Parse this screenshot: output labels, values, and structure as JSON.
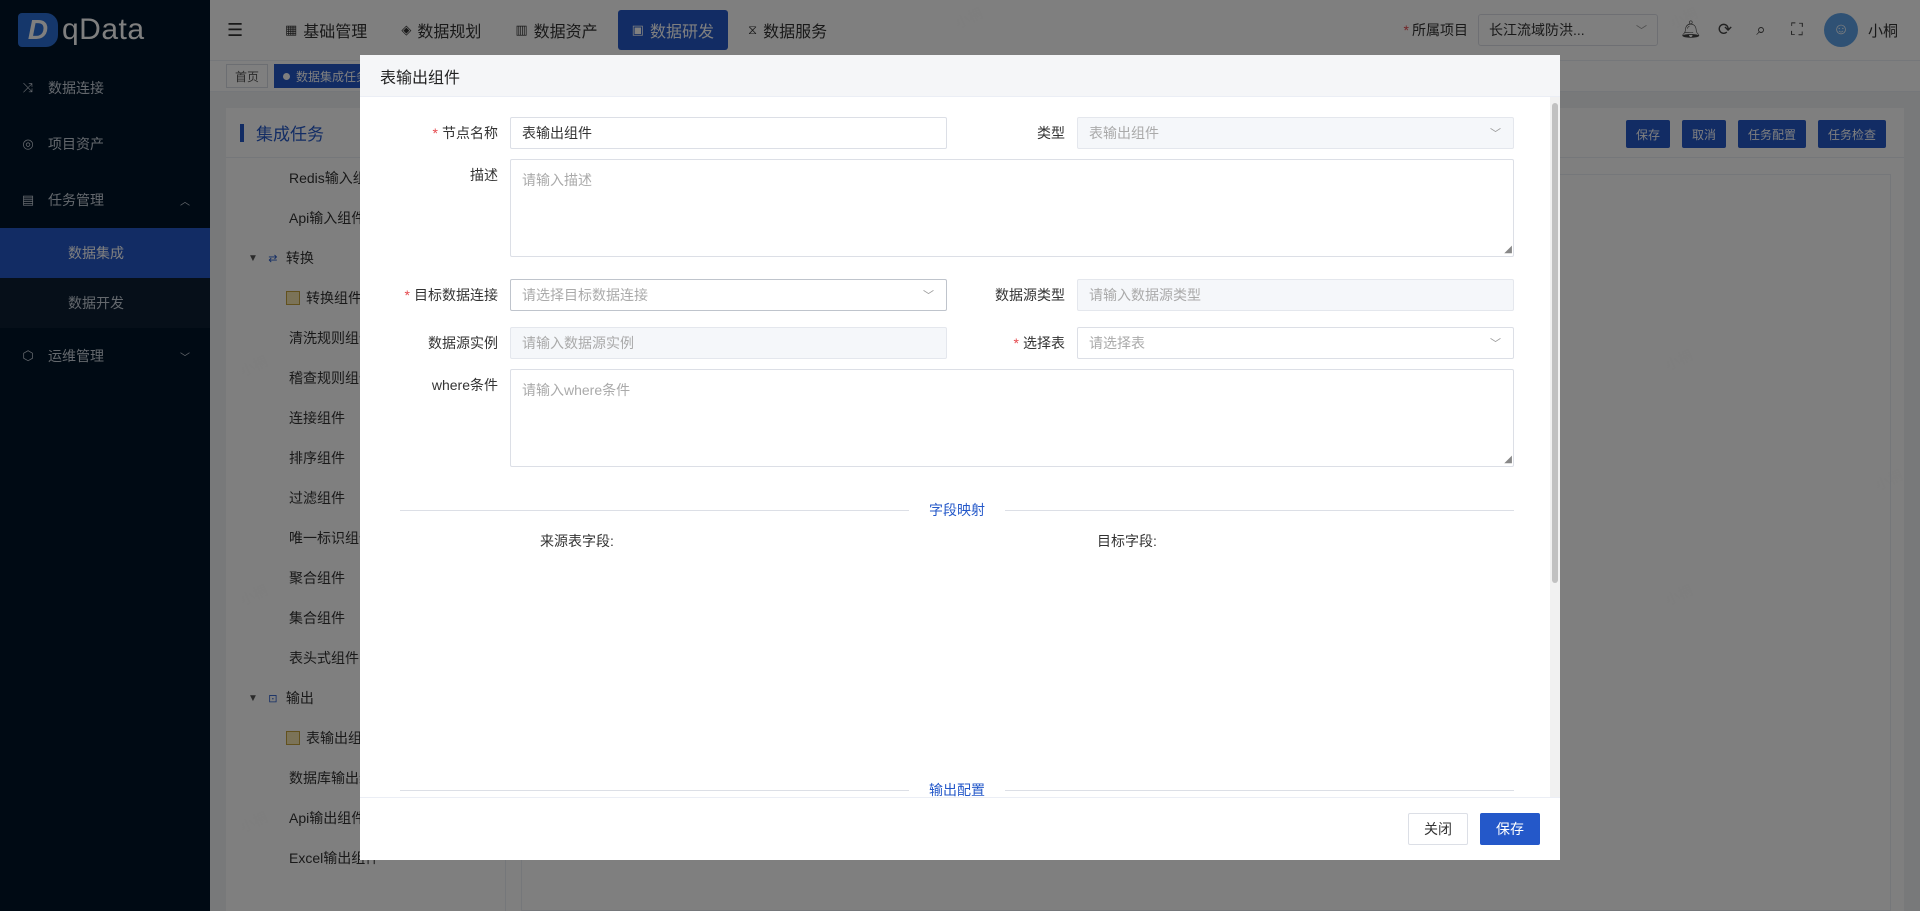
{
  "app": {
    "logo_text": "qData",
    "logo_mark": "D"
  },
  "sidebar": {
    "items": [
      {
        "label": "数据连接",
        "icon": "shuffle-icon",
        "glyph": "⤨"
      },
      {
        "label": "项目资产",
        "icon": "target-icon",
        "glyph": "◎"
      },
      {
        "label": "任务管理",
        "icon": "document-icon",
        "glyph": "▤",
        "arrow": "︿"
      },
      {
        "label": "运维管理",
        "icon": "cube-icon",
        "glyph": "⬡",
        "arrow": "﹀"
      }
    ],
    "subitems": [
      {
        "label": "数据集成",
        "active": true
      },
      {
        "label": "数据开发",
        "active": false
      }
    ]
  },
  "header": {
    "nav": [
      {
        "label": "基础管理",
        "glyph": "▦"
      },
      {
        "label": "数据规划",
        "glyph": "◈"
      },
      {
        "label": "数据资产",
        "glyph": "▥"
      },
      {
        "label": "数据研发",
        "glyph": "▣",
        "active": true
      },
      {
        "label": "数据服务",
        "glyph": "⧖"
      }
    ],
    "project_label": "所属项目",
    "project_value": "长江流域防洪...",
    "username": "小桐"
  },
  "tags": [
    {
      "label": "首页",
      "active": false
    },
    {
      "label": "数据集成任务",
      "active": true
    }
  ],
  "content": {
    "title": "集成任务",
    "actions": [
      "保存",
      "取消",
      "任务配置",
      "任务检查"
    ],
    "tree": [
      {
        "label": "Redis输入组件",
        "kind": "leaf"
      },
      {
        "label": "Api输入组件",
        "kind": "leaf"
      },
      {
        "label": "转换",
        "kind": "group",
        "glyph": "⇄"
      },
      {
        "label": "转换组件",
        "kind": "comp"
      },
      {
        "label": "清洗规则组件",
        "kind": "leaf"
      },
      {
        "label": "稽查规则组件",
        "kind": "leaf"
      },
      {
        "label": "连接组件",
        "kind": "leaf"
      },
      {
        "label": "排序组件",
        "kind": "leaf"
      },
      {
        "label": "过滤组件",
        "kind": "leaf"
      },
      {
        "label": "唯一标识组件",
        "kind": "leaf"
      },
      {
        "label": "聚合组件",
        "kind": "leaf"
      },
      {
        "label": "集合组件",
        "kind": "leaf"
      },
      {
        "label": "表头式组件",
        "kind": "leaf"
      },
      {
        "label": "输出",
        "kind": "group",
        "glyph": "⊡"
      },
      {
        "label": "表输出组件",
        "kind": "comp"
      },
      {
        "label": "数据库输出组件",
        "kind": "leaf"
      },
      {
        "label": "Api输出组件",
        "kind": "leaf"
      },
      {
        "label": "Excel输出组件",
        "kind": "leaf"
      }
    ]
  },
  "dialog": {
    "title": "表输出组件",
    "node_name_label": "节点名称",
    "node_name_value": "表输出组件",
    "type_label": "类型",
    "type_value": "表输出组件",
    "desc_label": "描述",
    "desc_placeholder": "请输入描述",
    "target_conn_label": "目标数据连接",
    "target_conn_placeholder": "请选择目标数据连接",
    "ds_type_label": "数据源类型",
    "ds_type_placeholder": "请输入数据源类型",
    "ds_instance_label": "数据源实例",
    "ds_instance_placeholder": "请输入数据源实例",
    "select_table_label": "选择表",
    "select_table_placeholder": "请选择表",
    "where_label": "where条件",
    "where_placeholder": "请输入where条件",
    "section_mapping": "字段映射",
    "source_fields_label": "来源表字段:",
    "target_fields_label": "目标字段:",
    "section_output": "输出配置",
    "close_label": "关闭",
    "save_label": "保存"
  },
  "watermark": "小桐",
  "colors": {
    "primary": "#2458c9",
    "sidebar_bg": "#001529",
    "required": "#e5484d"
  }
}
